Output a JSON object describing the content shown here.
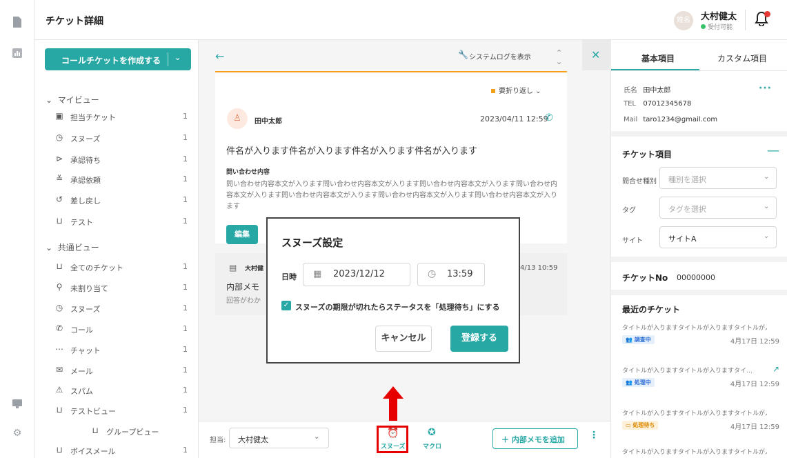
{
  "header": {
    "title": "チケット詳細",
    "avatar_label": "姓名",
    "user_name": "大村健太",
    "user_status": "受付可能"
  },
  "sidebar": {
    "create_button": "コールチケットを作成する",
    "my_view": {
      "label": "マイビュー",
      "items": [
        {
          "label": "担当チケット",
          "count": "1"
        },
        {
          "label": "スヌーズ",
          "count": "1"
        },
        {
          "label": "承認待ち",
          "count": "1"
        },
        {
          "label": "承認依頼",
          "count": "1"
        },
        {
          "label": "差し戻し",
          "count": "1"
        },
        {
          "label": "テスト",
          "count": "1"
        }
      ]
    },
    "shared_view": {
      "label": "共通ビュー",
      "items": [
        {
          "label": "全てのチケット",
          "count": "1"
        },
        {
          "label": "未割り当て",
          "count": "1"
        },
        {
          "label": "スヌーズ",
          "count": "1"
        },
        {
          "label": "コール",
          "count": "1"
        },
        {
          "label": "チャット",
          "count": "1"
        },
        {
          "label": "メール",
          "count": "1"
        },
        {
          "label": "スパム",
          "count": "1"
        },
        {
          "label": "テストビュー",
          "count": "1"
        },
        {
          "label": "グループビュー",
          "count": ""
        },
        {
          "label": "ボイスメール",
          "count": "1"
        }
      ]
    }
  },
  "center": {
    "system_log": "システムログを表示",
    "fold_label": "要折り返し",
    "message": {
      "sender": "田中太郎",
      "date": "2023/04/11 12:59",
      "subject": "件名が入ります件名が入ります件名が入ります件名が入ります",
      "inquiry_label": "問い合わせ内容",
      "inquiry_body": "問い合わせ内容本文が入ります問い合わせ内容本文が入ります問い合わせ内容本文が入ります問い合わせ内容本文が入ります問い合わせ内容本文が入ります問い合わせ内容本文が入ります問い合わせ内容本文が入ります",
      "edit_button": "編集"
    },
    "memo": {
      "author": "大村健",
      "date": "4/13 10:59",
      "title": "内部メモ",
      "body": "回答がわか"
    }
  },
  "bottom_bar": {
    "assignee_label": "担当:",
    "assignee_value": "大村健太",
    "snooze_label": "スヌーズ",
    "macro_label": "マクロ",
    "add_memo_button": "内部メモを追加"
  },
  "right_panel": {
    "tabs": [
      "基本項目",
      "カスタム項目"
    ],
    "contact": [
      {
        "key": "氏名",
        "value": "田中太郎"
      },
      {
        "key": "TEL",
        "value": "07012345678"
      },
      {
        "key": "Mail",
        "value": "taro1234@gmail.com"
      }
    ],
    "ticket_items_title": "チケット項目",
    "fields": [
      {
        "label": "問合せ種別",
        "value": "種別を選択",
        "placeholder": true
      },
      {
        "label": "タグ",
        "value": "タグを選択",
        "placeholder": true
      },
      {
        "label": "サイト",
        "value": "サイトA",
        "placeholder": false
      }
    ],
    "ticket_no_label": "チケットNo",
    "ticket_no_value": "00000000",
    "recent_title": "最近のチケット",
    "recent": [
      {
        "title": "タイトルが入りますタイトルが入りますタイトルが入ります",
        "badge": "調査中",
        "badge_color": "#2e6fd6",
        "date": "4月17日 12:59"
      },
      {
        "title": "タイトルが入りますタイトルが入りますタイ…",
        "badge": "処理中",
        "badge_color": "#2e6fd6",
        "date": "4月17日 12:59"
      },
      {
        "title": "タイトルが入りますタイトルが入りますタイトルが入ります",
        "badge": "処理待ち",
        "badge_color": "#e08a00",
        "date": "4月17日 12:59"
      },
      {
        "title": "タイトルが入りますタイトルが入りますタイトルが入ります",
        "badge": "",
        "badge_color": "",
        "date": ""
      }
    ]
  },
  "modal": {
    "title": "スヌーズ設定",
    "datetime_label": "日時",
    "date_value": "2023/12/12",
    "time_value": "13:59",
    "checkbox_label": "スヌーズの期限が切れたらステータスを「処理待ち」にする",
    "cancel_button": "キャンセル",
    "submit_button": "登録する"
  },
  "colors": {
    "accent": "#28a8a5",
    "highlight": "#e60000"
  }
}
